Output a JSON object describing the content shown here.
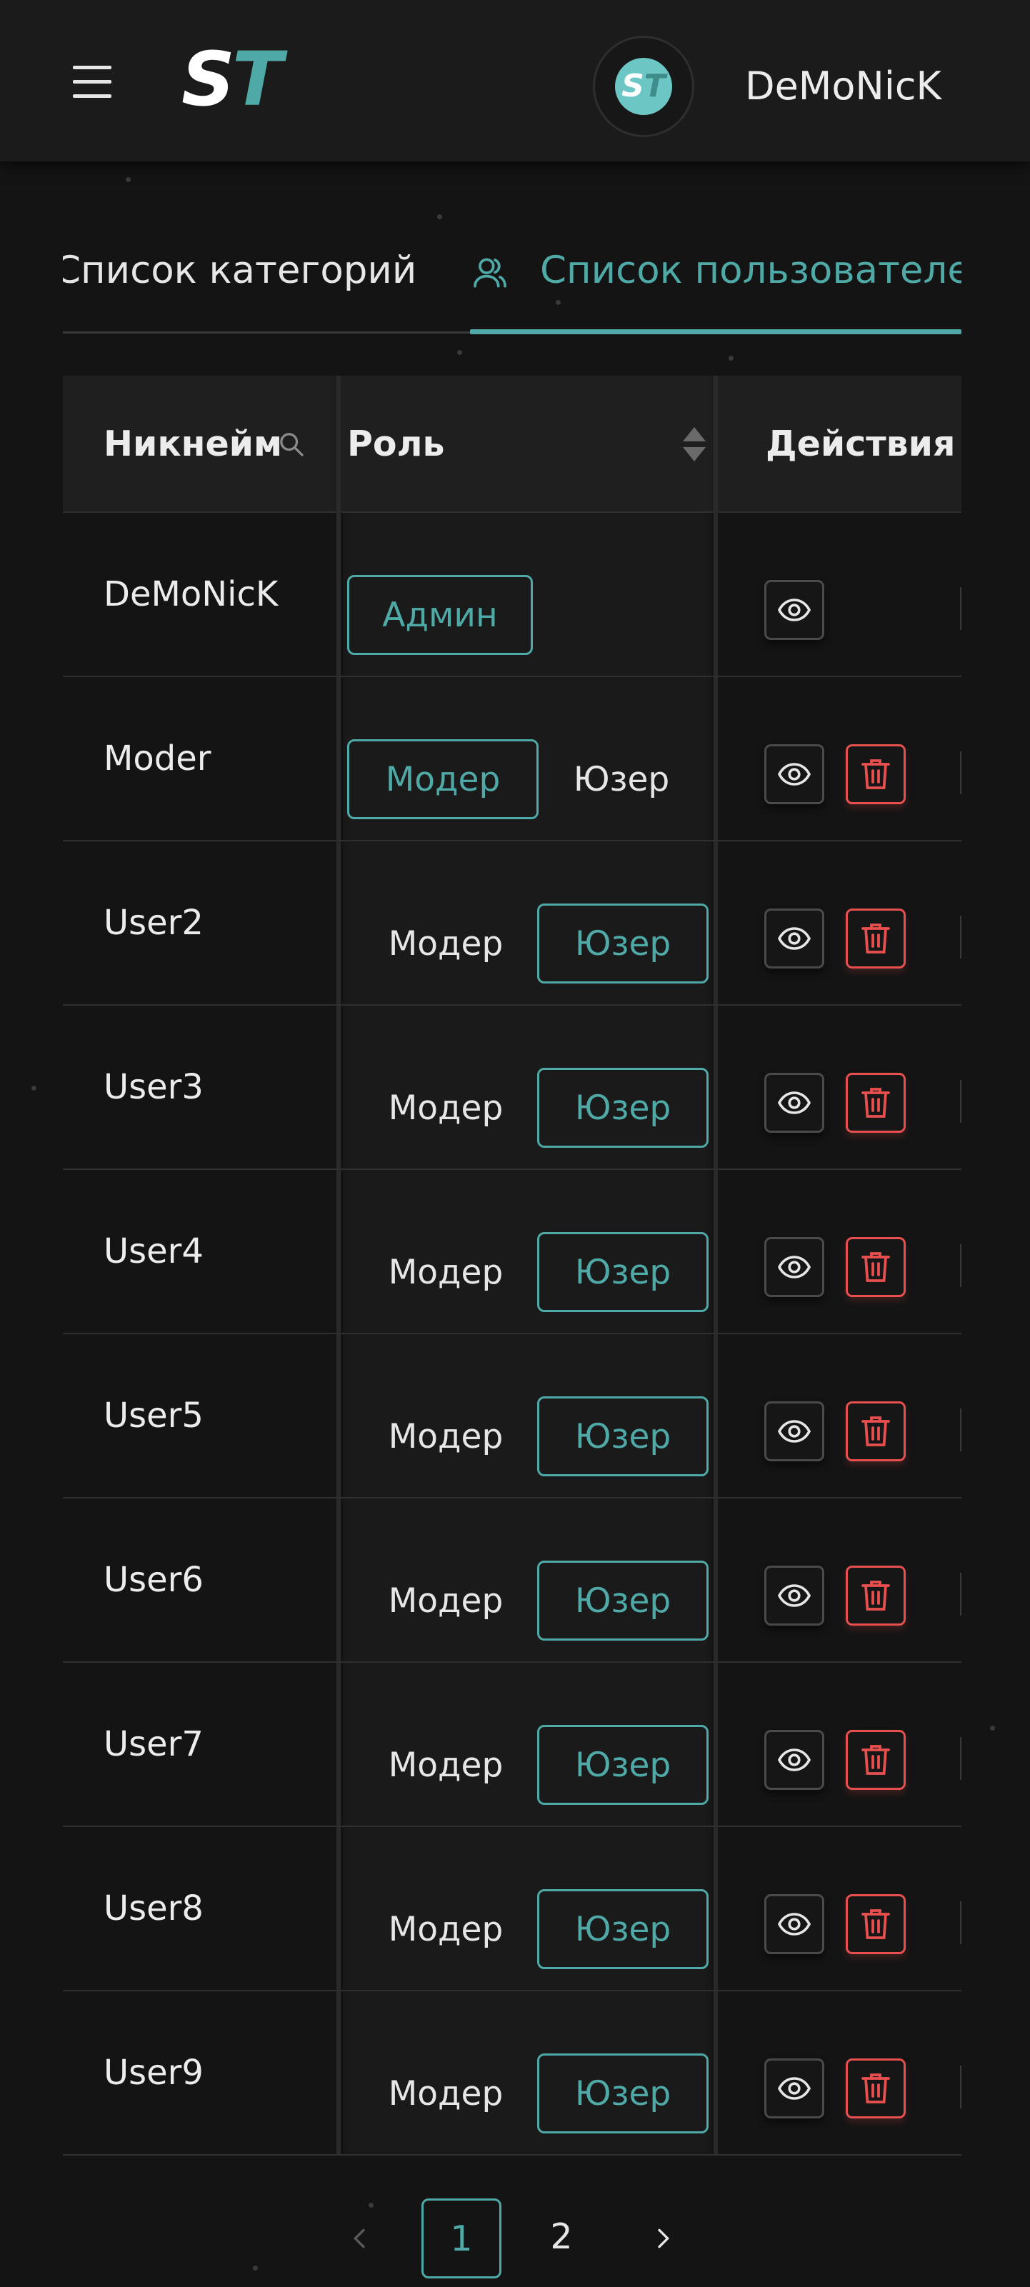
{
  "header": {
    "logo_s": "S",
    "logo_t": "T",
    "avatar_s": "S",
    "avatar_t": "T",
    "username": "DeMoNicK"
  },
  "tabs": [
    {
      "label": "Список категорий",
      "active": false
    },
    {
      "label": "Список пользователей",
      "active": true,
      "icon": "user-group-icon"
    }
  ],
  "table": {
    "columns": {
      "nickname": "Никнейм",
      "role": "Роль",
      "actions": "Действия"
    },
    "rows": [
      {
        "nick": "DeMoNicK",
        "roles": [
          "Админ"
        ],
        "selected": "Админ",
        "can_delete": false
      },
      {
        "nick": "Moder",
        "roles": [
          "Модер",
          "Юзер"
        ],
        "selected": "Модер",
        "can_delete": true
      },
      {
        "nick": "User2",
        "roles": [
          "Модер",
          "Юзер"
        ],
        "selected": "Юзер",
        "can_delete": true
      },
      {
        "nick": "User3",
        "roles": [
          "Модер",
          "Юзер"
        ],
        "selected": "Юзер",
        "can_delete": true
      },
      {
        "nick": "User4",
        "roles": [
          "Модер",
          "Юзер"
        ],
        "selected": "Юзер",
        "can_delete": true
      },
      {
        "nick": "User5",
        "roles": [
          "Модер",
          "Юзер"
        ],
        "selected": "Юзер",
        "can_delete": true
      },
      {
        "nick": "User6",
        "roles": [
          "Модер",
          "Юзер"
        ],
        "selected": "Юзер",
        "can_delete": true
      },
      {
        "nick": "User7",
        "roles": [
          "Модер",
          "Юзер"
        ],
        "selected": "Юзер",
        "can_delete": true
      },
      {
        "nick": "User8",
        "roles": [
          "Модер",
          "Юзер"
        ],
        "selected": "Юзер",
        "can_delete": true
      },
      {
        "nick": "User9",
        "roles": [
          "Модер",
          "Юзер"
        ],
        "selected": "Юзер",
        "can_delete": true
      }
    ]
  },
  "pagination": {
    "pages": [
      "1",
      "2"
    ],
    "current": "1"
  },
  "colors": {
    "accent": "#4fa9a6",
    "danger": "#e8504f",
    "background": "#141414"
  }
}
